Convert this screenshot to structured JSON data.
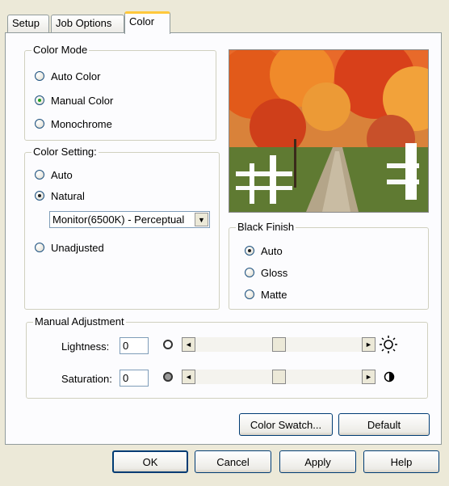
{
  "tabs": [
    {
      "label": "Setup"
    },
    {
      "label": "Job Options"
    },
    {
      "label": "Color"
    }
  ],
  "color_mode": {
    "title": "Color Mode",
    "options": [
      "Auto Color",
      "Manual Color",
      "Monochrome"
    ],
    "selected": "Manual Color"
  },
  "color_setting": {
    "title": "Color Setting:",
    "options": [
      "Auto",
      "Natural",
      "Unadjusted"
    ],
    "selected": "Natural",
    "profile_select": "Monitor(6500K) - Perceptual"
  },
  "black_finish": {
    "title": "Black Finish",
    "options": [
      "Auto",
      "Gloss",
      "Matte"
    ],
    "selected": "Auto"
  },
  "manual_adjustment": {
    "title": "Manual Adjustment",
    "lightness": {
      "label": "Lightness:",
      "value": "0",
      "slider_fraction": 0.5
    },
    "saturation": {
      "label": "Saturation:",
      "value": "0",
      "slider_fraction": 0.5
    }
  },
  "panel_buttons": {
    "color_swatch": "Color Swatch...",
    "default": "Default"
  },
  "dialog_buttons": {
    "ok": "OK",
    "cancel": "Cancel",
    "apply": "Apply",
    "help": "Help"
  },
  "icons": {
    "lightness_low": "circle-outline-icon",
    "lightness_high": "sun-icon",
    "saturation_low": "gray-circle-icon",
    "saturation_high": "half-circle-icon",
    "arrow_left": "◄",
    "arrow_right": "►",
    "dropdown": "▼"
  },
  "colors": {
    "active_tab_accent": "#ffc83c",
    "dialog_bg": "#ece9d8",
    "panel_bg": "#fcfcfe"
  }
}
